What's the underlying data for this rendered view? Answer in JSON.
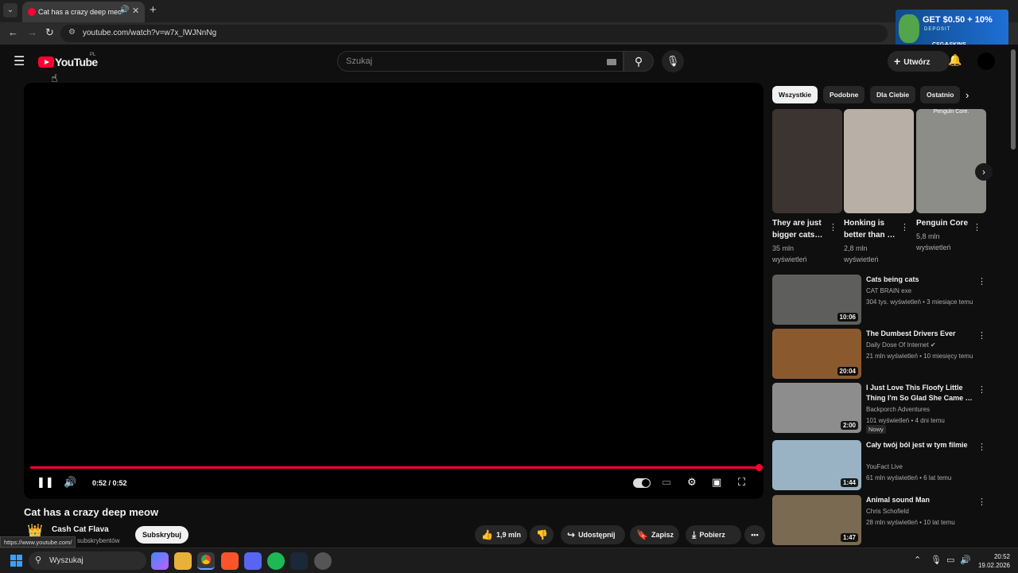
{
  "browser": {
    "tab_title": "Cat has a crazy deep meow",
    "url": "youtube.com/watch?v=w7x_lWJNnNg",
    "status_url": "https://www.youtube.com/"
  },
  "ad": {
    "headline": "GET $0.50 + 10%",
    "sub": "DEPOSIT",
    "brand": "CSG☘SKINS"
  },
  "header": {
    "logo_text": "YouTube",
    "country": "PL",
    "search_placeholder": "Szukaj",
    "create_label": "Utwórz"
  },
  "player": {
    "time": "0:52 / 0:52",
    "progress": 1.0
  },
  "video": {
    "title": "Cat has a crazy deep meow",
    "channel": "Cash Cat Flava",
    "subscribers": "subskrybentów",
    "subscribe_label": "Subskrybuj",
    "likes": "1,9 mln",
    "share_label": "Udostępnij",
    "save_label": "Zapisz",
    "download_label": "Pobierz"
  },
  "chips": [
    "Wszystkie",
    "Podobne",
    "Dla Ciebie",
    "Ostatnio"
  ],
  "shorts": [
    {
      "title": "They are just bigger cats…",
      "views": "35 mln wyświetleń",
      "color": "#3b3430"
    },
    {
      "title": "Honking is better than …",
      "views": "2,8 mln wyświetleń",
      "color": "#b8b0a6"
    },
    {
      "title": "Penguin Core",
      "views": "5,8 mln wyświetleń",
      "color": "#8c8c88",
      "overlay": "Penguin Core."
    }
  ],
  "recommendations": [
    {
      "title": "Cats being cats",
      "channel": "CAT BRAIN exe",
      "meta": "304 tys. wyświetleń • 3 miesiące temu",
      "duration": "10:06",
      "color": "#5e5e5c"
    },
    {
      "title": "The Dumbest Drivers Ever",
      "channel": "Daily Dose Of Internet",
      "meta": "21 mln wyświetleń • 10 miesięcy temu",
      "duration": "20:04",
      "color": "#8a5a2e",
      "verified": true
    },
    {
      "title": "I Just Love This Floofy Little Thing I'm So Glad She Came …",
      "channel": "Backporch Adventures",
      "meta": "101 wyświetleń • 4 dni temu",
      "duration": "2:00",
      "color": "#8d8d8d",
      "badge": "Nowy"
    },
    {
      "title": "Cały twój ból jest w tym filmie",
      "channel": "YouFact Live",
      "meta": "61 mln wyświetleń • 6 lat temu",
      "duration": "1:44",
      "color": "#9ab3c4"
    },
    {
      "title": "Animal sound Man",
      "channel": "Chris Schofield",
      "meta": "28 mln wyświetleń • 10 lat temu",
      "duration": "1:47",
      "color": "#7a6a52"
    }
  ],
  "taskbar": {
    "search_label": "Wyszukaj",
    "time": "20:52",
    "date": "19.02.2026"
  }
}
